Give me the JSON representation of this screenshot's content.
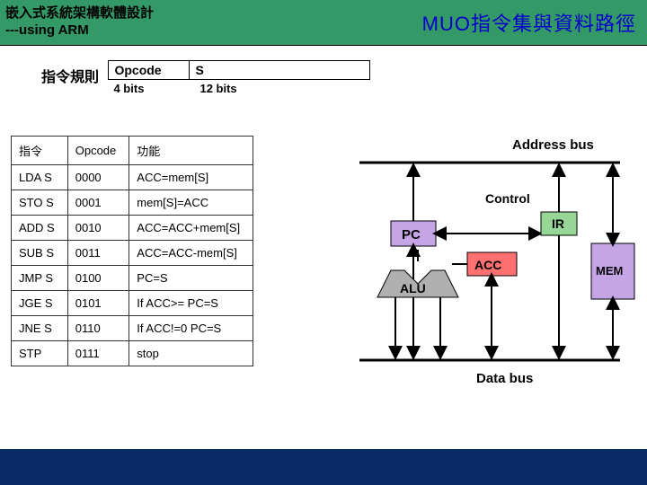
{
  "header": {
    "title_line1": "嵌入式系統架構軟體設計",
    "title_line2": "---using ARM",
    "slide_title": "MUO指令集與資料路徑"
  },
  "opspec": {
    "label": "指令規則",
    "col_opcode": "Opcode",
    "col_s": "S",
    "bits_opcode": "4 bits",
    "bits_s": "12 bits"
  },
  "itable": {
    "headers": {
      "instr": "指令",
      "opcode": "Opcode",
      "func": "功能"
    },
    "rows": [
      {
        "instr": "LDA S",
        "opcode": "0000",
        "func": "ACC=mem[S]"
      },
      {
        "instr": "STO S",
        "opcode": "0001",
        "func": "mem[S]=ACC"
      },
      {
        "instr": "ADD S",
        "opcode": "0010",
        "func": "ACC=ACC+mem[S]"
      },
      {
        "instr": "SUB S",
        "opcode": "0011",
        "func": "ACC=ACC-mem[S]"
      },
      {
        "instr": "JMP S",
        "opcode": "0100",
        "func": "PC=S"
      },
      {
        "instr": "JGE S",
        "opcode": "0101",
        "func": "If ACC>= PC=S"
      },
      {
        "instr": "JNE S",
        "opcode": "0110",
        "func": "If ACC!=0 PC=S"
      },
      {
        "instr": "STP",
        "opcode": "0111",
        "func": "stop"
      }
    ]
  },
  "diagram": {
    "address_bus": "Address bus",
    "data_bus": "Data bus",
    "control": "Control",
    "pc": "PC",
    "ir": "IR",
    "alu": "ALU",
    "acc": "ACC",
    "mem": "MEM"
  }
}
